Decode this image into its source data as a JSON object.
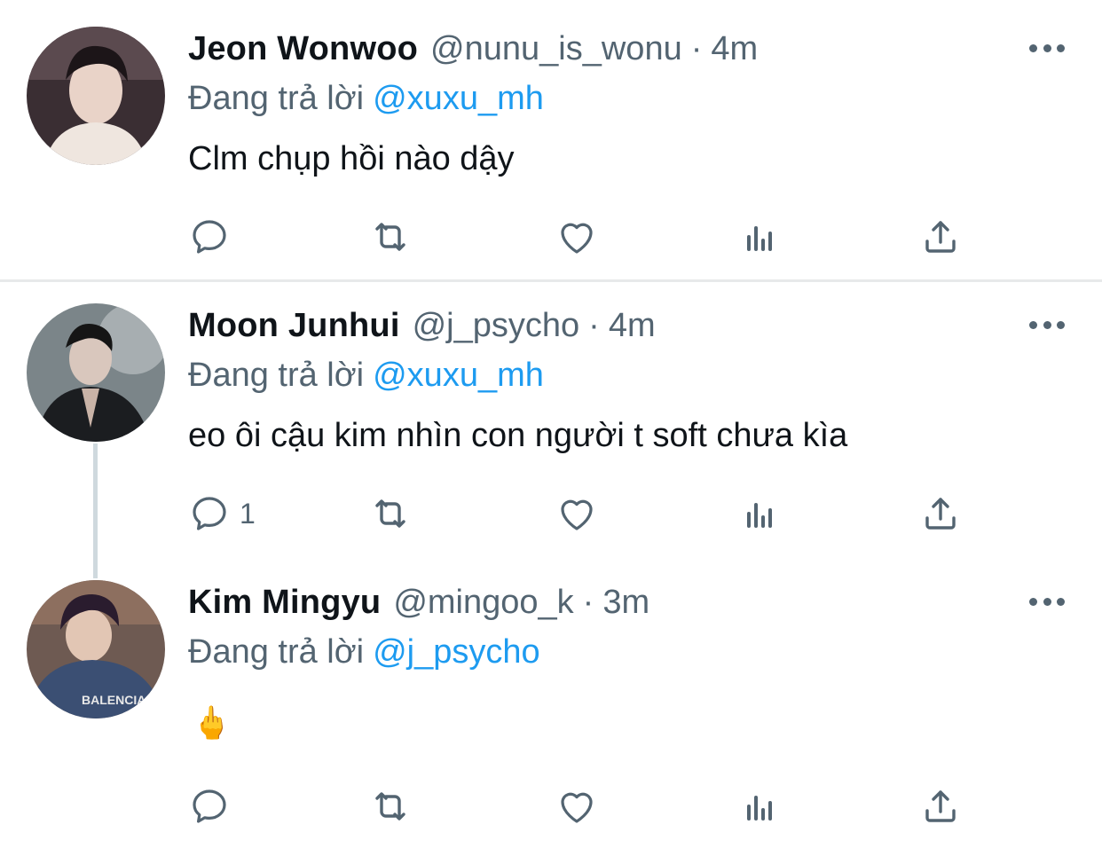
{
  "colors": {
    "text": "#0f1419",
    "secondary": "#536471",
    "accent": "#1d9bf0",
    "divider": "#e7e9ea"
  },
  "tweets": [
    {
      "name": "Jeon Wonwoo",
      "handle": "@nunu_is_wonu",
      "separator": "·",
      "time": "4m",
      "replying_prefix": "Đang trả lời",
      "replying_to": "@xuxu_mh",
      "text": "Clm chụp hồi nào dậy",
      "reply_count": "",
      "icons": [
        "reply-icon",
        "retweet-icon",
        "like-icon",
        "analytics-icon",
        "share-icon"
      ]
    },
    {
      "name": "Moon Junhui",
      "handle": "@j_psycho",
      "separator": "·",
      "time": "4m",
      "replying_prefix": "Đang trả lời",
      "replying_to": "@xuxu_mh",
      "text": "eo ôi cậu kim nhìn con người t soft chưa kìa",
      "reply_count": "1",
      "icons": [
        "reply-icon",
        "retweet-icon",
        "like-icon",
        "analytics-icon",
        "share-icon"
      ]
    },
    {
      "name": "Kim Mingyu",
      "handle": "@mingoo_k",
      "separator": "·",
      "time": "3m",
      "replying_prefix": "Đang trả lời",
      "replying_to": "@j_psycho",
      "text": "🖕",
      "reply_count": "",
      "icons": [
        "reply-icon",
        "retweet-icon",
        "like-icon",
        "analytics-icon",
        "share-icon"
      ]
    }
  ]
}
